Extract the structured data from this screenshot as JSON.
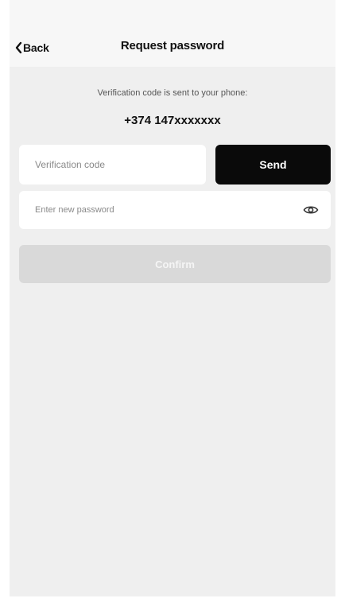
{
  "header": {
    "back_label": "Back",
    "title": "Request password"
  },
  "main": {
    "info_text": "Verification code is sent to your phone:",
    "phone_number": "+374 147xxxxxxx",
    "code_placeholder": "Verification code",
    "send_label": "Send",
    "password_placeholder": "Enter new password",
    "confirm_label": "Confirm"
  },
  "icons": {
    "back": "chevron-left-icon",
    "password_toggle": "eye-icon"
  },
  "colors": {
    "header_bg": "#f7f7f7",
    "content_bg": "#efefef",
    "send_button_bg": "#0a0a0a",
    "confirm_button_bg_disabled": "#d9d9d9"
  }
}
